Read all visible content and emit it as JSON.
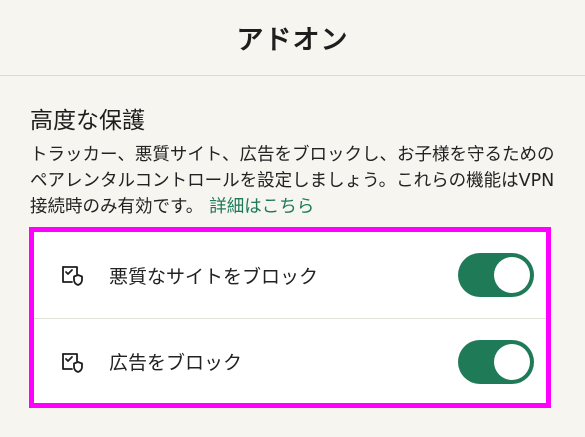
{
  "header": {
    "title": "アドオン"
  },
  "section": {
    "title": "高度な保護",
    "description": "トラッカー、悪質サイト、広告をブロックし、お子様を守るためのペアレンタルコントロールを設定しましょう。これらの機能はVPN接続時のみ有効です。",
    "link_label": "詳細はこちら"
  },
  "items": [
    {
      "label": "悪質なサイトをブロック",
      "icon": "shield-check-icon",
      "enabled": true
    },
    {
      "label": "広告をブロック",
      "icon": "shield-check-icon",
      "enabled": true
    }
  ],
  "colors": {
    "accent": "#1f7a58",
    "highlight": "#ff00ff",
    "background": "#f6f5ef"
  }
}
